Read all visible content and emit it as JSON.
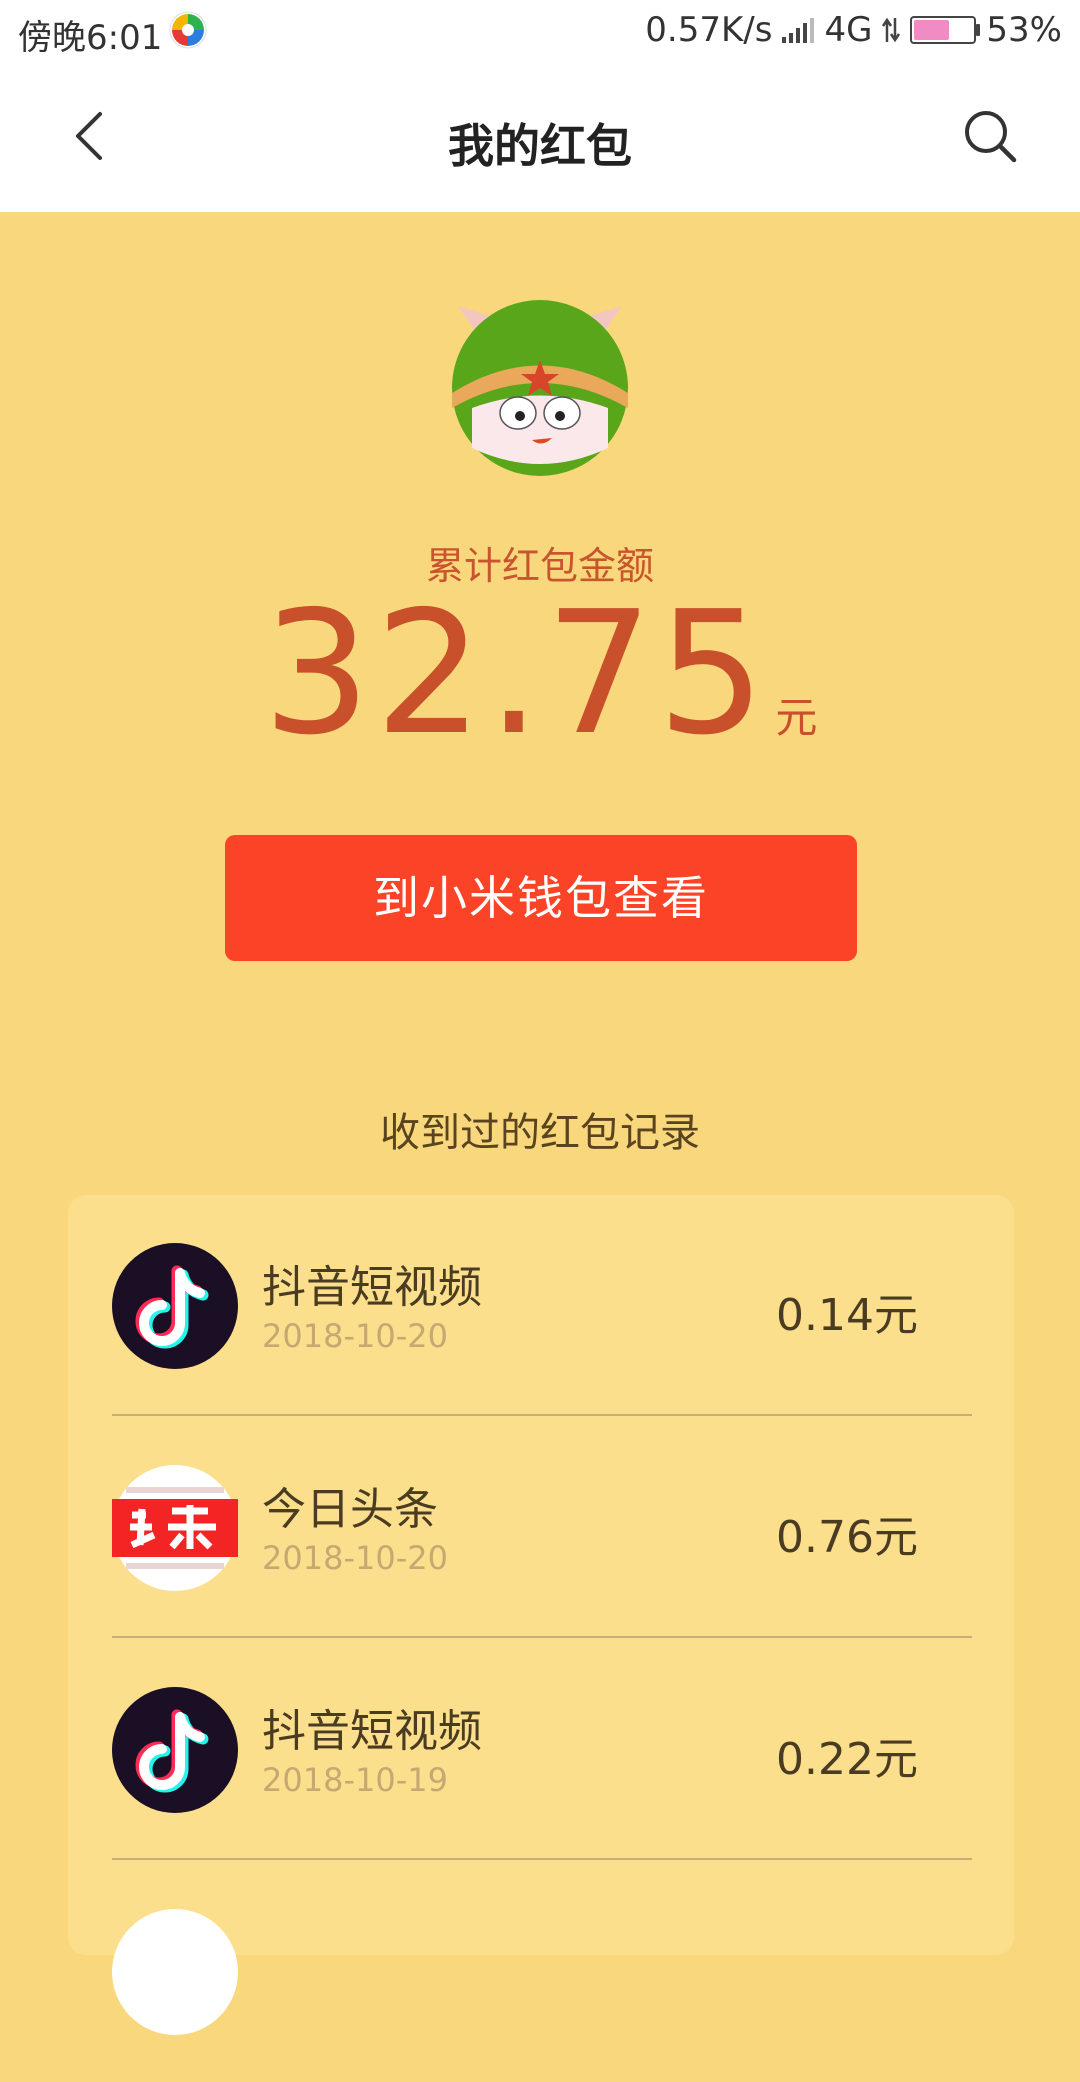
{
  "status_bar": {
    "time": "傍晚6:01",
    "network_speed": "0.57K/s",
    "network_type": "4G",
    "battery": "53%"
  },
  "nav": {
    "title": "我的红包"
  },
  "summary": {
    "label": "累计红包金额",
    "amount": "32.75",
    "unit": "元"
  },
  "wallet_button": "到小米钱包查看",
  "records_title": "收到过的红包记录",
  "records": [
    {
      "name": "抖音短视频",
      "date": "2018-10-20",
      "amount": "0.14元",
      "icon": "douyin-icon"
    },
    {
      "name": "今日头条",
      "date": "2018-10-20",
      "amount": "0.76元",
      "icon": "toutiao-icon"
    },
    {
      "name": "抖音短视频",
      "date": "2018-10-19",
      "amount": "0.22元",
      "icon": "douyin-icon"
    }
  ],
  "colors": {
    "page_bg": "#f9d77c",
    "card_bg": "#fbdf8c",
    "accent_button": "#fb4427",
    "amount_text": "#c8502a"
  }
}
